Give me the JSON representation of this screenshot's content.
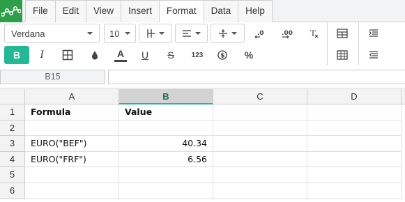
{
  "app": {
    "logo_icon": "spreadsheet-logo-icon",
    "brand_color": "#2e9e49",
    "accent_color": "#23b896"
  },
  "menu": {
    "tabs": [
      "File",
      "Edit",
      "View",
      "Insert",
      "Format",
      "Data",
      "Help"
    ],
    "active": "Format"
  },
  "toolbar": {
    "font_name": "Verdana",
    "font_size": "10",
    "bold_label": "B",
    "italic_label": "I",
    "underline_label": "U",
    "strike_label": "S",
    "number_format_label": "123",
    "percent_label": "%",
    "clear_format_label": "Tx",
    "text_color_label": "A",
    "decrease_decimals_label": ".0",
    "increase_decimals_label": ".00",
    "icons": [
      "borders-icon",
      "align-left-icon",
      "vertical-align-icon",
      "decrease-decimals-icon",
      "increase-decimals-icon",
      "clear-format-icon",
      "merge-cells-icon",
      "fill-color-icon",
      "text-color-icon",
      "currency-icon",
      "table-icon",
      "indent-icon",
      "outdent-icon"
    ]
  },
  "formula_bar": {
    "cell_reference": "B15",
    "formula": ""
  },
  "sheet": {
    "columns": [
      "A",
      "B",
      "C",
      "D"
    ],
    "selected_column": "B",
    "rows": [
      "1",
      "2",
      "3",
      "4",
      "5",
      "6"
    ],
    "cells": [
      [
        "Formula",
        "Value",
        "",
        ""
      ],
      [
        "",
        "",
        "",
        ""
      ],
      [
        "EURO(\"BEF\")",
        "40.34",
        "",
        ""
      ],
      [
        "EURO(\"FRF\")",
        "6.56",
        "",
        ""
      ],
      [
        "",
        "",
        "",
        ""
      ],
      [
        "",
        "",
        "",
        ""
      ]
    ]
  }
}
